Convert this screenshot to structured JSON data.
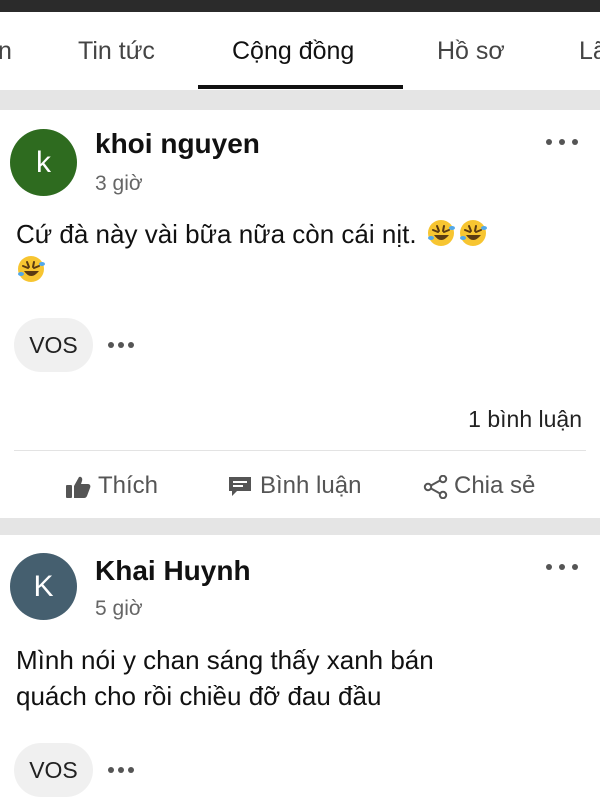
{
  "tabs": [
    {
      "label": "n"
    },
    {
      "label": "Tin tức"
    },
    {
      "label": "Cộng đồng",
      "active": true
    },
    {
      "label": "Hồ sơ"
    },
    {
      "label": "Lã"
    }
  ],
  "posts": [
    {
      "avatar_letter": "k",
      "avatar_color": "#2e6b1f",
      "author": "khoi nguyen",
      "time": "3 giờ",
      "body": "Cứ đà này vài bữa nữa còn cái nịt.",
      "emoji": "rolling-on-floor-laughing-icon",
      "tag": "VOS",
      "comment_count": "1 bình luận",
      "actions": {
        "like": "Thích",
        "comment": "Bình luận",
        "share": "Chia sẻ"
      }
    },
    {
      "avatar_letter": "K",
      "avatar_color": "#455f6f",
      "author": "Khai Huynh",
      "time": "5 giờ",
      "body_line1": "Mình nói y chan sáng thấy xanh bán",
      "body_line2": "quách cho rồi chiều đỡ đau đầu",
      "tag": "VOS"
    }
  ],
  "colors": {
    "separator": "#e5e5e5",
    "text": "#111111",
    "muted": "#666666",
    "chip": "#f0f0f0"
  }
}
